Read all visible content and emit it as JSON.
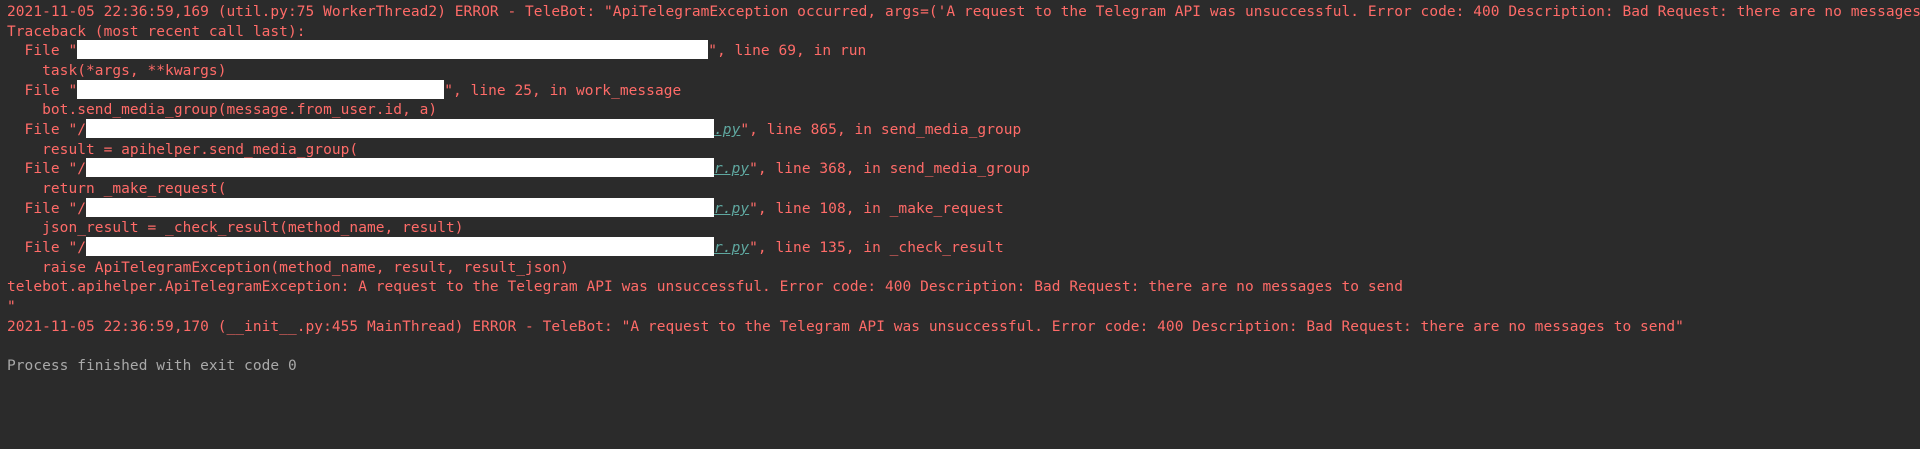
{
  "console": {
    "lines": {
      "l0": "2021-11-05 22:36:59,169 (util.py:75 WorkerThread2) ERROR - TeleBot: \"ApiTelegramException occurred, args=('A request to the Telegram API was unsuccessful. Error code: 400 Description: Bad Request: there are no messages to send",
      "l1": "Traceback (most recent call last):",
      "l2_pre": "  File \"",
      "l2_post": "\", line 69, in run",
      "l3": "    task(*args, **kwargs)",
      "l4_pre": "  File \"",
      "l4_post": "\", line 25, in work_message",
      "l5": "    bot.send_media_group(message.from_user.id, a)",
      "l6_pre": "  File \"/",
      "l6_link": ".py",
      "l6_post": "\", line 865, in send_media_group",
      "l7": "    result = apihelper.send_media_group(",
      "l8_pre": "  File \"/",
      "l8_link": "r.py",
      "l8_post": "\", line 368, in send_media_group",
      "l9": "    return _make_request(",
      "l10_pre": "  File \"/",
      "l10_link": "r.py",
      "l10_post": "\", line 108, in _make_request",
      "l11": "    json_result = _check_result(method_name, result)",
      "l12_pre": "  File \"/",
      "l12_link": "r.py",
      "l12_post": "\", line 135, in _check_result",
      "l13": "    raise ApiTelegramException(method_name, result, result_json)",
      "l14": "telebot.apihelper.ApiTelegramException: A request to the Telegram API was unsuccessful. Error code: 400 Description: Bad Request: there are no messages to send",
      "l15": "\"",
      "l16": "2021-11-05 22:36:59,170 (__init__.py:455 MainThread) ERROR - TeleBot: \"A request to the Telegram API was unsuccessful. Error code: 400 Description: Bad Request: there are no messages to send\"",
      "l17": "",
      "l18": "Process finished with exit code 0"
    },
    "colors": {
      "background": "#2b2b2b",
      "error_text": "#ff6b68",
      "normal_text": "#a9a9a9",
      "link_text": "#5fa8a0",
      "redaction": "#ffffff"
    }
  }
}
